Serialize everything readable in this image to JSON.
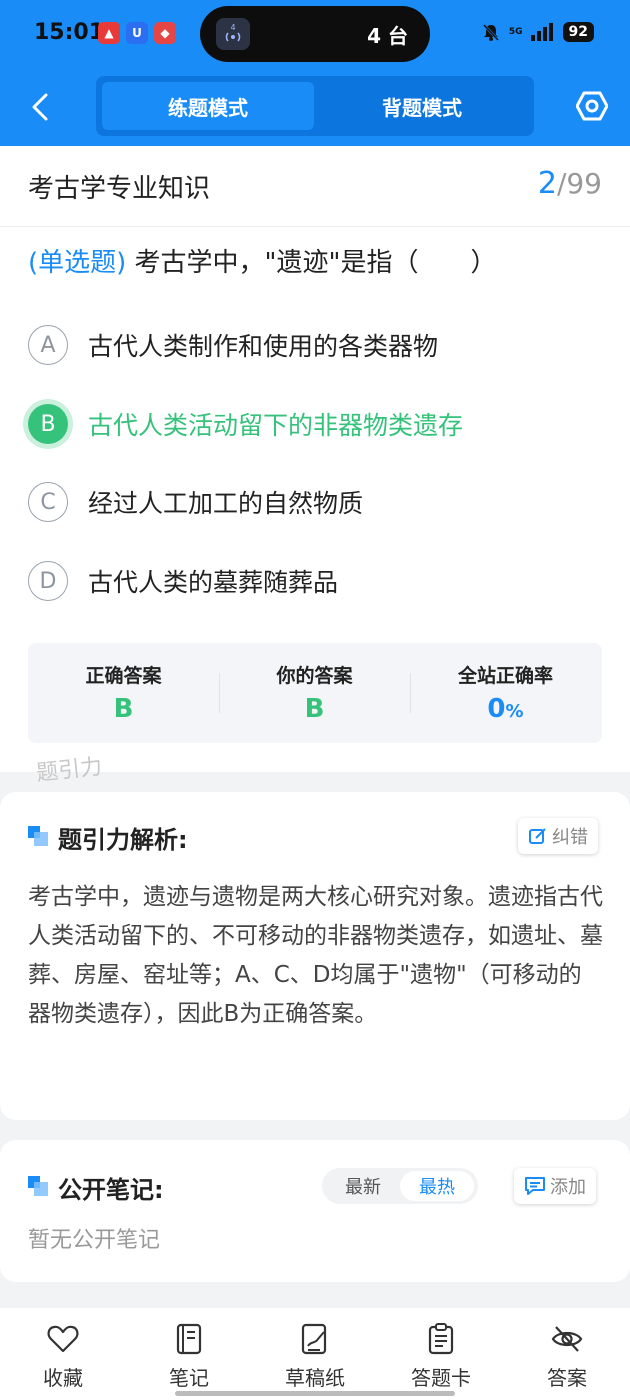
{
  "status_bar": {
    "time": "15:01",
    "island_text": "4 台",
    "island_badge": "4",
    "network": "5G",
    "battery": "92"
  },
  "nav": {
    "tabs": [
      "练题模式",
      "背题模式"
    ],
    "active_tab": "练题模式"
  },
  "title_bar": {
    "title": "考古学专业知识",
    "current": "2",
    "total": "/99"
  },
  "question": {
    "type": "(单选题)",
    "text": " 考古学中，\"遗迹\"是指（　　）",
    "options": [
      {
        "letter": "A",
        "text": "古代人类制作和使用的各类器物",
        "state": "normal"
      },
      {
        "letter": "B",
        "text": "古代人类活动留下的非器物类遗存",
        "state": "correct"
      },
      {
        "letter": "C",
        "text": "经过人工加工的自然物质",
        "state": "normal"
      },
      {
        "letter": "D",
        "text": "古代人类的墓葬随葬品",
        "state": "normal"
      }
    ]
  },
  "answer_summary": {
    "correct_label": "正确答案",
    "correct_value": "B",
    "yours_label": "你的答案",
    "yours_value": "B",
    "rate_label": "全站正确率",
    "rate_value": "0",
    "rate_unit": "%"
  },
  "watermark": "题引力",
  "analysis": {
    "title": "题引力解析:",
    "report_button": "纠错",
    "text": "考古学中，遗迹与遗物是两大核心研究对象。遗迹指古代人类活动留下的、不可移动的非器物类遗存，如遗址、墓葬、房屋、窑址等；A、C、D均属于\"遗物\"（可移动的器物类遗存），因此B为正确答案。"
  },
  "notes": {
    "title": "公开笔记:",
    "sort_options": [
      "最新",
      "最热"
    ],
    "active_sort": "最热",
    "add_button": "添加",
    "empty_text": "暂无公开笔记"
  },
  "bottom_nav": [
    {
      "label": "收藏",
      "icon": "heart-icon"
    },
    {
      "label": "笔记",
      "icon": "notebook-icon"
    },
    {
      "label": "草稿纸",
      "icon": "draft-icon"
    },
    {
      "label": "答题卡",
      "icon": "answer-card-icon"
    },
    {
      "label": "答案",
      "icon": "eye-off-icon"
    }
  ],
  "colors": {
    "primary": "#1a8cf7",
    "correct": "#35c27a"
  }
}
